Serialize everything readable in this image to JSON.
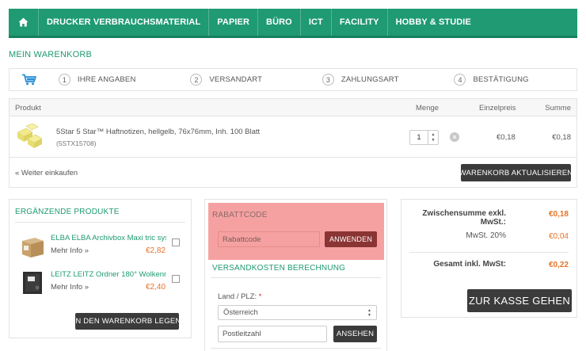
{
  "nav": {
    "home_icon": "home-icon",
    "items": [
      {
        "label": "DRUCKER VERBRAUCHSMATERIAL"
      },
      {
        "label": "PAPIER"
      },
      {
        "label": "BÜRO"
      },
      {
        "label": "ICT"
      },
      {
        "label": "FACILITY"
      },
      {
        "label": "HOBBY & STUDIE"
      }
    ]
  },
  "page_title": "MEIN WARENKORB",
  "steps": {
    "cart_icon": "shopping-cart-icon",
    "items": [
      {
        "num": "1",
        "label": "IHRE ANGABEN"
      },
      {
        "num": "2",
        "label": "VERSANDART"
      },
      {
        "num": "3",
        "label": "ZAHLUNGSART"
      },
      {
        "num": "4",
        "label": "BESTÄTIGUNG"
      }
    ]
  },
  "cart": {
    "headers": {
      "product": "Produkt",
      "qty": "Menge",
      "unit_price": "Einzelpreis",
      "sum": "Summe"
    },
    "row": {
      "name": "5Star 5 Star™ Haftnotizen, hellgelb, 76x76mm, Inh. 100 Blatt",
      "sku": "(5STX15708)",
      "qty": "1",
      "unit_price": "€0,18",
      "sum": "€0,18"
    },
    "continue_label": "« Weiter einkaufen",
    "update_label": "WARENKORB AKTUALISIEREN"
  },
  "related": {
    "title": "ERGÄNZENDE PRODUKTE",
    "items": [
      {
        "name": "ELBA ELBA Archivbox Maxi tric sys",
        "more": "Mehr Info »",
        "price": "€2,82"
      },
      {
        "name": "LEITZ LEITZ Ordner 180° Wolkenm",
        "more": "Mehr Info »",
        "price": "€2,40"
      }
    ],
    "button_label": "IN DEN WARENKORB LEGEN"
  },
  "coupon": {
    "title": "RABATTCODE",
    "placeholder": "Rabattcode",
    "apply_label": "ANWENDEN"
  },
  "shipping": {
    "title": "VERSANDKOSTEN BERECHNUNG",
    "land_label": "Land / PLZ:",
    "required_mark": "*",
    "country": "Österreich",
    "zip_placeholder": "Postleitzahl",
    "button_label": "ANSEHEN"
  },
  "totals": {
    "subtotal_label_1": "Zwischensumme exkl.",
    "subtotal_label_2": "MwSt.:",
    "subtotal_value": "€0,18",
    "tax_label": "MwSt. 20%",
    "tax_value": "€0,04",
    "total_label": "Gesamt inkl. MwSt:",
    "total_value": "€0,22",
    "checkout_label": "ZUR KASSE GEHEN"
  },
  "colors": {
    "brand_green": "#1f9a72",
    "accent_orange": "#e6732a",
    "dark_button": "#3b3b3b",
    "coupon_highlight": "#f6a1a1"
  }
}
